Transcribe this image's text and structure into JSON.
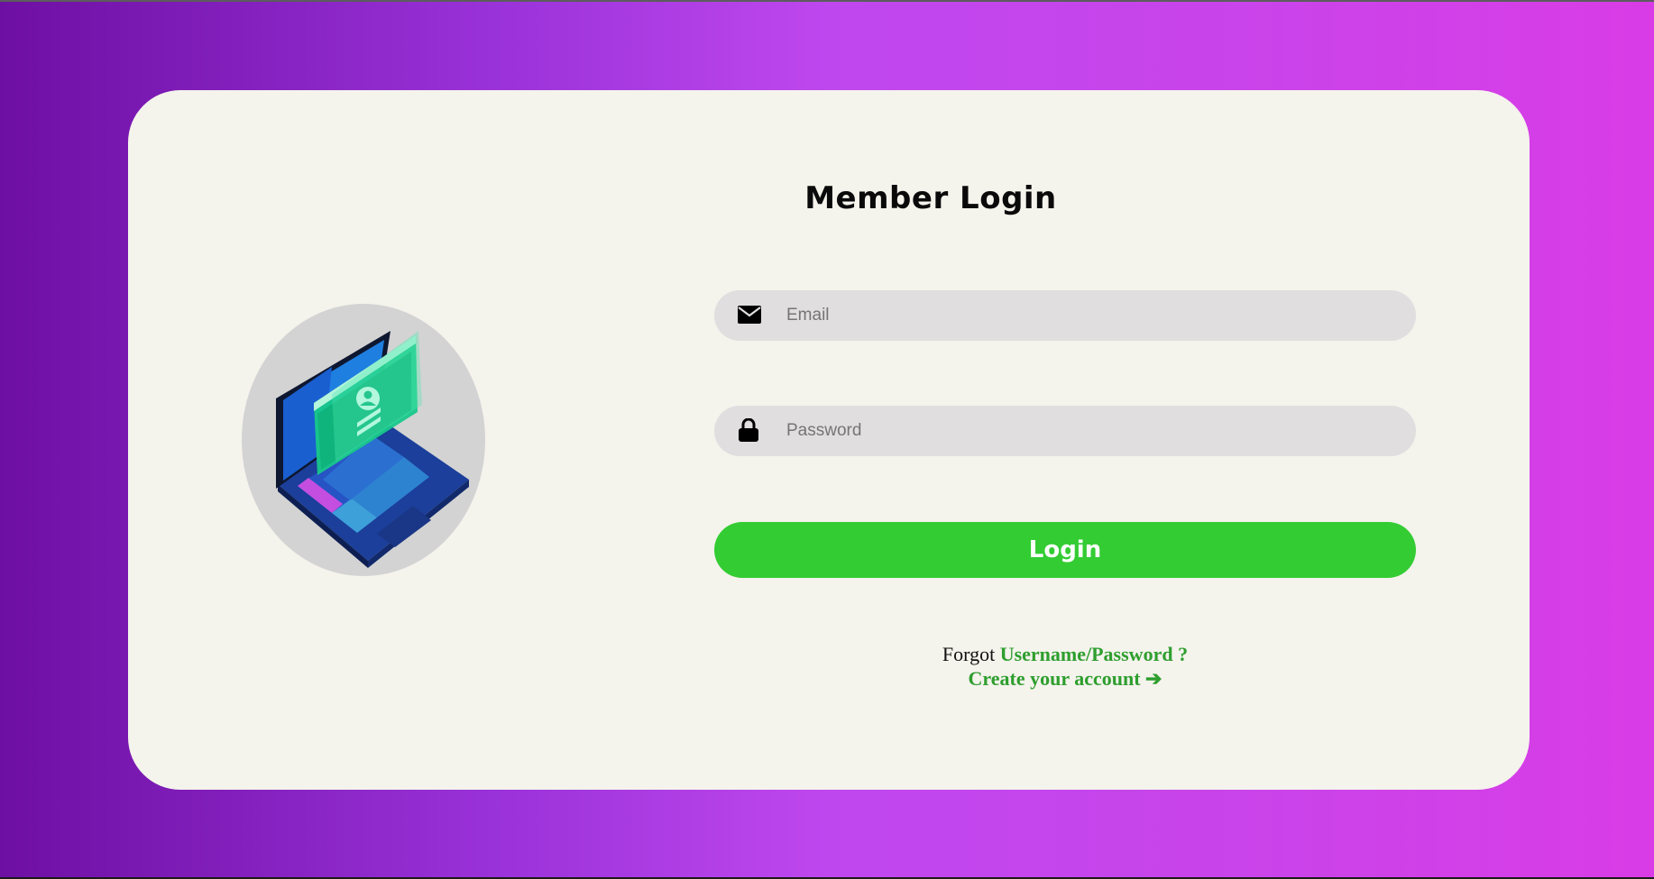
{
  "login_form": {
    "title": "Member Login",
    "email": {
      "placeholder": "Email",
      "value": ""
    },
    "password": {
      "placeholder": "Password",
      "value": ""
    },
    "login_button_label": "Login"
  },
  "footer_links": {
    "forgot_prefix": "Forgot",
    "forgot_link": "Username/Password ?",
    "create_account_link": "Create your account ➔"
  },
  "icons": {
    "email_icon": "envelope-icon",
    "password_icon": "lock-icon"
  },
  "colors": {
    "background_gradient_start": "#6e0fa3",
    "background_gradient_mid": "#bf47ee",
    "background_gradient_end": "#d93ce6",
    "card": "#f4f3ec",
    "input_bg": "#e0dedf",
    "login_button": "#33cc33",
    "link_green": "#2e9e2e"
  }
}
